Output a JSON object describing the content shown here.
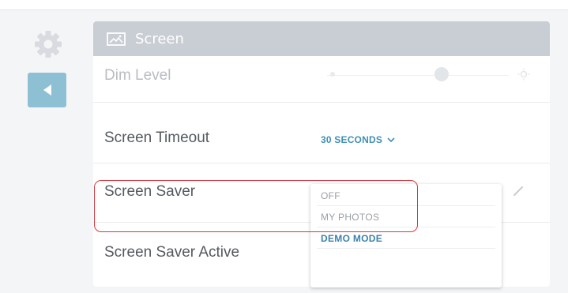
{
  "header": {
    "title": "Screen",
    "icon": "screen-image-icon"
  },
  "nav": {
    "settings_icon": "gear-icon",
    "back_icon": "back-arrow-icon"
  },
  "rows": {
    "dim_level": {
      "label": "Dim Level",
      "slider_value_fraction": 0.62
    },
    "timeout": {
      "label": "Screen Timeout",
      "value": "30 SECONDS"
    },
    "saver": {
      "label": "Screen Saver"
    },
    "active": {
      "label": "Screen Saver Active"
    }
  },
  "dropdown": {
    "options": [
      "OFF",
      "MY PHOTOS",
      "DEMO MODE"
    ],
    "selected": "DEMO MODE"
  },
  "colors": {
    "accent": "#3f8fb4",
    "highlight": "#d9363e",
    "header_bg": "#c9ced4",
    "back_button": "#8ec0d3"
  }
}
